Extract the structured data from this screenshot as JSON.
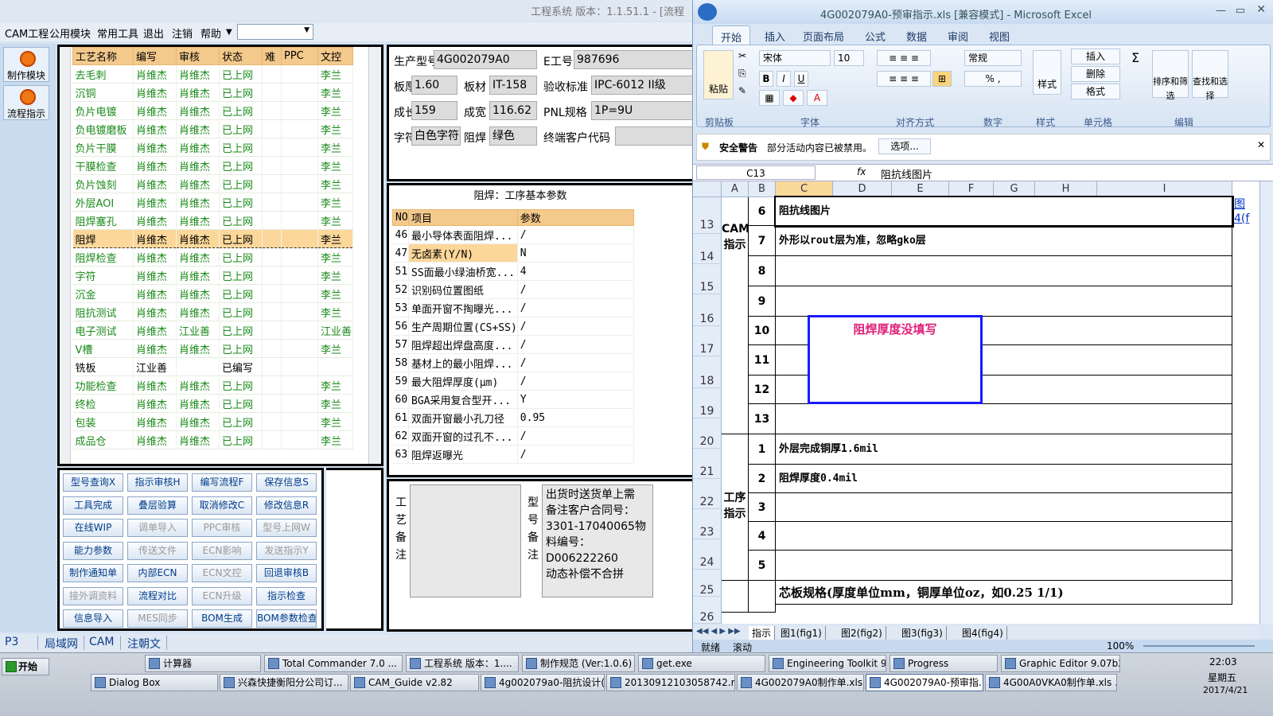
{
  "app": {
    "title": "工程系统  版本：1.1.51.1 - [流程",
    "menu": [
      "CAM工程",
      "公用模块",
      "常用工具",
      "退出",
      "注销",
      "帮助"
    ],
    "rail": [
      "制作模块",
      "流程指示"
    ]
  },
  "process_grid": {
    "headers": [
      "工艺名称",
      "编写",
      "审核",
      "状态",
      "难",
      "PPC",
      "文控"
    ],
    "rows": [
      [
        "去毛刺",
        "肖维杰",
        "肖维杰",
        "已上网",
        "",
        "",
        "李兰"
      ],
      [
        "沉铜",
        "肖维杰",
        "肖维杰",
        "已上网",
        "",
        "",
        "李兰"
      ],
      [
        "负片电镀",
        "肖维杰",
        "肖维杰",
        "已上网",
        "",
        "",
        "李兰"
      ],
      [
        "负电镀磨板",
        "肖维杰",
        "肖维杰",
        "已上网",
        "",
        "",
        "李兰"
      ],
      [
        "负片干膜",
        "肖维杰",
        "肖维杰",
        "已上网",
        "",
        "",
        "李兰"
      ],
      [
        "干膜检查",
        "肖维杰",
        "肖维杰",
        "已上网",
        "",
        "",
        "李兰"
      ],
      [
        "负片蚀刻",
        "肖维杰",
        "肖维杰",
        "已上网",
        "",
        "",
        "李兰"
      ],
      [
        "外层AOI",
        "肖维杰",
        "肖维杰",
        "已上网",
        "",
        "",
        "李兰"
      ],
      [
        "阻焊塞孔",
        "肖维杰",
        "肖维杰",
        "已上网",
        "",
        "",
        "李兰"
      ],
      [
        "阻焊",
        "肖维杰",
        "肖维杰",
        "已上网",
        "",
        "",
        "李兰"
      ],
      [
        "阻焊检查",
        "肖维杰",
        "肖维杰",
        "已上网",
        "",
        "",
        "李兰"
      ],
      [
        "字符",
        "肖维杰",
        "肖维杰",
        "已上网",
        "",
        "",
        "李兰"
      ],
      [
        "沉金",
        "肖维杰",
        "肖维杰",
        "已上网",
        "",
        "",
        "李兰"
      ],
      [
        "阻抗测试",
        "肖维杰",
        "肖维杰",
        "已上网",
        "",
        "",
        "李兰"
      ],
      [
        "电子测试",
        "肖维杰",
        "江业善",
        "已上网",
        "",
        "",
        "江业善"
      ],
      [
        "V槽",
        "肖维杰",
        "肖维杰",
        "已上网",
        "",
        "",
        "李兰"
      ],
      [
        "铣板",
        "江业善",
        "",
        "已编写",
        "",
        "",
        ""
      ],
      [
        "功能检查",
        "肖维杰",
        "肖维杰",
        "已上网",
        "",
        "",
        "李兰"
      ],
      [
        "终检",
        "肖维杰",
        "肖维杰",
        "已上网",
        "",
        "",
        "李兰"
      ],
      [
        "包装",
        "肖维杰",
        "肖维杰",
        "已上网",
        "",
        "",
        "李兰"
      ],
      [
        "成品仓",
        "肖维杰",
        "肖维杰",
        "已上网",
        "",
        "",
        "李兰"
      ]
    ],
    "selected_index": 9
  },
  "buttons": [
    {
      "label": "型号查询X",
      "enabled": true
    },
    {
      "label": "指示审核H",
      "enabled": true
    },
    {
      "label": "编写流程F",
      "enabled": true
    },
    {
      "label": "保存信息S",
      "enabled": true
    },
    {
      "label": "工具完成",
      "enabled": true
    },
    {
      "label": "叠层验算",
      "enabled": true
    },
    {
      "label": "取消修改C",
      "enabled": true
    },
    {
      "label": "修改信息R",
      "enabled": true
    },
    {
      "label": "在线WIP",
      "enabled": true
    },
    {
      "label": "调单导入",
      "enabled": false
    },
    {
      "label": "PPC审核",
      "enabled": false
    },
    {
      "label": "型号上网W",
      "enabled": false
    },
    {
      "label": "能力参数",
      "enabled": true
    },
    {
      "label": "传送文件",
      "enabled": false
    },
    {
      "label": "ECN影响",
      "enabled": false
    },
    {
      "label": "发送指示Y",
      "enabled": false
    },
    {
      "label": "制作通知单",
      "enabled": true
    },
    {
      "label": "内部ECN",
      "enabled": true
    },
    {
      "label": "ECN文控",
      "enabled": false
    },
    {
      "label": "回退审核B",
      "enabled": true
    },
    {
      "label": "接外调资料",
      "enabled": false
    },
    {
      "label": "流程对比",
      "enabled": true
    },
    {
      "label": "ECN升级",
      "enabled": false
    },
    {
      "label": "指示检查",
      "enabled": true
    },
    {
      "label": "信息导入",
      "enabled": true
    },
    {
      "label": "MES同步",
      "enabled": false
    },
    {
      "label": "BOM生成",
      "enabled": true
    },
    {
      "label": "BOM参数检查",
      "enabled": true
    }
  ],
  "info": {
    "model_label": "生产型号",
    "model": "4G002079A0",
    "eno_label": "E工号",
    "eno": "987696",
    "thick_label": "板厚",
    "thick": "1.60",
    "mat_label": "板材",
    "mat": "IT-158",
    "std_label": "验收标准",
    "std": "IPC-6012 II级",
    "len_label": "成长",
    "len": "159",
    "wid_label": "成宽",
    "wid": "116.62",
    "pnl_label": "PNL规格",
    "pnl": "1P=9U",
    "char_label": "字符",
    "char": "白色字符",
    "mask_label": "阻焊",
    "mask": "绿色",
    "cust_label": "终端客户代码",
    "cust": ""
  },
  "params": {
    "title": "阻焊：工序基本参数",
    "headers": [
      "NO",
      "项目",
      "参数"
    ],
    "rows": [
      [
        "46",
        "最小导体表面阻焊...",
        "/"
      ],
      [
        "47",
        "无卤素(Y/N)",
        "N"
      ],
      [
        "51",
        "SS面最小绿油桥宽...",
        "4"
      ],
      [
        "52",
        "识别码位置图纸",
        "/"
      ],
      [
        "53",
        "单面开窗不掏曝光...",
        "/"
      ],
      [
        "56",
        "生产周期位置(CS+SS)",
        "/"
      ],
      [
        "57",
        "阻焊超出焊盘高度...",
        "/"
      ],
      [
        "58",
        "基材上的最小阻焊...",
        "/"
      ],
      [
        "59",
        "最大阻焊厚度(μm)",
        "/"
      ],
      [
        "60",
        "BGA采用复合型开...",
        "Y"
      ],
      [
        "61",
        "双面开窗最小孔刀径",
        "0.95"
      ],
      [
        "62",
        "双面开窗的过孔不...",
        "/"
      ],
      [
        "63",
        "阻焊返曝光",
        "/"
      ]
    ]
  },
  "notes": {
    "proc_label": "工艺备注",
    "model_label": "型号备注",
    "model_note": [
      "出货时送货单上需",
      "备注客户合同号：",
      "3301-17040065物",
      "料编号：",
      "D006222260",
      "动态补偿不合拼"
    ]
  },
  "bottom_tabs": [
    "P3",
    "局域网",
    "CAM",
    "注朝文"
  ],
  "excel": {
    "title": "4G002079A0-预审指示.xls  [兼容模式] - Microsoft Excel",
    "tabs": [
      "开始",
      "插入",
      "页面布局",
      "公式",
      "数据",
      "审阅",
      "视图"
    ],
    "font": "宋体",
    "size": "10",
    "numfmt": "常规",
    "groups": [
      "剪贴板",
      "字体",
      "对齐方式",
      "数字",
      "样式",
      "单元格",
      "编辑"
    ],
    "ribbon": {
      "paste": "粘贴",
      "insert": "插入",
      "delete": "删除",
      "format": "格式",
      "style": "样式",
      "sort": "排序和筛选",
      "find": "查找和选择"
    },
    "security": {
      "title": "安全警告",
      "text": "部分活动内容已被禁用。",
      "button": "选项..."
    },
    "namebox": "C13",
    "formula": "阻抗线图片",
    "columns": [
      "A",
      "B",
      "C",
      "D",
      "E",
      "F",
      "G",
      "H",
      "I"
    ],
    "rows": [
      "13",
      "14",
      "15",
      "16",
      "17",
      "18",
      "19",
      "20",
      "21",
      "22",
      "23",
      "24",
      "25",
      "26"
    ],
    "section1": "CAM指示",
    "section2": "工序指示",
    "nums1": [
      "6",
      "7",
      "8",
      "9",
      "10",
      "11",
      "12",
      "13"
    ],
    "nums2": [
      "1",
      "2",
      "3",
      "4",
      "5"
    ],
    "cam_lines": [
      "阻抗线图片",
      "外形以rout层为准，忽略gko层"
    ],
    "proc_lines": [
      "外层完成铜厚1.6mil",
      "阻焊厚度0.4mil"
    ],
    "callout": "阻焊厚度没填写",
    "core_spec": "芯板规格(厚度单位mm，铜厚单位oz，如0.25 1/1)",
    "link_text": "图",
    "link_text2": "4(f",
    "sheets": [
      "指示",
      "图1(fig1)",
      "图2(fig2)",
      "图3(fig3)",
      "图4(fig4)"
    ],
    "status": [
      "就绪",
      "滚动"
    ],
    "zoom": "100%"
  },
  "taskbar": {
    "start": "开始",
    "row1": [
      "计算器",
      "Total Commander 7.0 ...",
      "工程系统  版本：1....",
      "制作规范 (Ver:1.0.6)",
      "get.exe",
      "Engineering Toolkit 9....",
      "Progress",
      "Graphic Editor 9.07b2 ..."
    ],
    "row2": [
      "Dialog Box",
      "兴森快捷衡阳分公司订...",
      "CAM_Guide v2.82",
      "4g002079a0-阻抗设计(...",
      "20130912103058742.rtf...",
      "4G002079A0制作单.xls ...",
      "4G002079A0-预审指...",
      "4G00A0VKA0制作单.xls ..."
    ],
    "time": "22:03",
    "weekday": "星期五",
    "date": "2017/4/21"
  }
}
